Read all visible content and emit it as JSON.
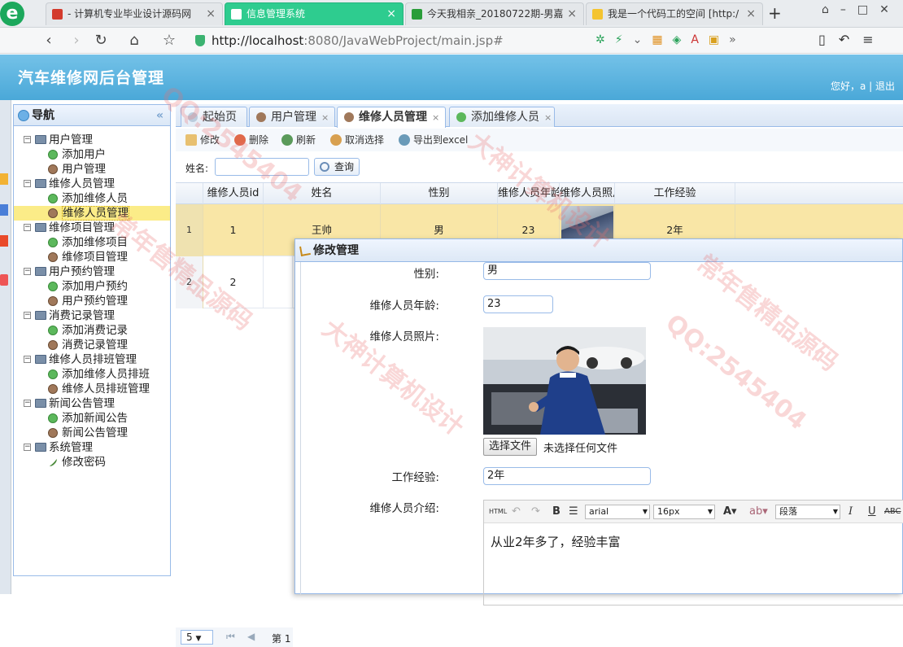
{
  "browser": {
    "tabs": [
      {
        "title": "- 计算机专业毕业设计源码网",
        "active": false,
        "color": "#d33a2c"
      },
      {
        "title": "信息管理系统",
        "active": true,
        "color": "#ffffff"
      },
      {
        "title": "今天我相亲_20180722期-男嘉",
        "active": false,
        "color": "#2a9d3a"
      },
      {
        "title": "我是一个代码工的空间 [http:/",
        "active": false,
        "color": "#f4c430"
      }
    ],
    "new_tab": "+",
    "url_host": "http://localhost",
    "url_rest": ":8080/JavaWebProject/main.jsp#"
  },
  "app": {
    "title": "汽车维修网后台管理",
    "greeting": "您好，a",
    "logout": "退出"
  },
  "nav": {
    "title": "导航",
    "groups": [
      {
        "label": "用户管理",
        "items": [
          {
            "label": "添加用户",
            "icon": "add"
          },
          {
            "label": "用户管理",
            "icon": "user"
          }
        ]
      },
      {
        "label": "维修人员管理",
        "items": [
          {
            "label": "添加维修人员",
            "icon": "add"
          },
          {
            "label": "维修人员管理",
            "icon": "user",
            "selected": true
          }
        ]
      },
      {
        "label": "维修项目管理",
        "items": [
          {
            "label": "添加维修项目",
            "icon": "add"
          },
          {
            "label": "维修项目管理",
            "icon": "user"
          }
        ]
      },
      {
        "label": "用户预约管理",
        "items": [
          {
            "label": "添加用户预约",
            "icon": "add"
          },
          {
            "label": "用户预约管理",
            "icon": "user"
          }
        ]
      },
      {
        "label": "消费记录管理",
        "items": [
          {
            "label": "添加消费记录",
            "icon": "add"
          },
          {
            "label": "消费记录管理",
            "icon": "user"
          }
        ]
      },
      {
        "label": "维修人员排班管理",
        "items": [
          {
            "label": "添加维修人员排班",
            "icon": "add"
          },
          {
            "label": "维修人员排班管理",
            "icon": "user"
          }
        ]
      },
      {
        "label": "新闻公告管理",
        "items": [
          {
            "label": "添加新闻公告",
            "icon": "add"
          },
          {
            "label": "新闻公告管理",
            "icon": "user"
          }
        ]
      },
      {
        "label": "系统管理",
        "items": [
          {
            "label": "修改密码",
            "icon": "pen"
          }
        ]
      }
    ]
  },
  "main": {
    "tabs": [
      {
        "label": "起始页",
        "closable": false
      },
      {
        "label": "用户管理",
        "closable": true
      },
      {
        "label": "维修人员管理",
        "closable": true,
        "active": true
      },
      {
        "label": "添加维修人员",
        "closable": true
      }
    ],
    "toolbar": {
      "edit": "修改",
      "delete": "删除",
      "refresh": "刷新",
      "cancel": "取消选择",
      "export": "导出到excel"
    },
    "search": {
      "name_label": "姓名:",
      "name_value": "",
      "query": "查询"
    },
    "grid": {
      "columns": [
        "维修人员id",
        "姓名",
        "性别",
        "维修人员年龄",
        "维修人员照片",
        "工作经验"
      ],
      "rows": [
        {
          "rownum": "1",
          "id": "1",
          "name": "王帅",
          "sex": "男",
          "age": "23",
          "exp": "2年",
          "selected": true
        },
        {
          "rownum": "2",
          "id": "2",
          "name": "",
          "sex": "",
          "age": "",
          "exp": "",
          "selected": false
        }
      ]
    },
    "pager": {
      "page_size": "5",
      "page_label": "第 1"
    }
  },
  "modal": {
    "title": "修改管理",
    "fields": {
      "sex_label": "性别:",
      "sex_value": "男",
      "age_label": "维修人员年龄:",
      "age_value": "23",
      "photo_label": "维修人员照片:",
      "file_button": "选择文件",
      "file_status": "未选择任何文件",
      "exp_label": "工作经验:",
      "exp_value": "2年",
      "intro_label": "维修人员介绍:"
    },
    "editor": {
      "font": "arial",
      "size": "16px",
      "paragraph": "段落",
      "content": "从业2年多了，经验丰富"
    }
  },
  "watermark": {
    "text1": "QQ:2545404",
    "text2": "大神计算机设计",
    "text3": "常年售精品源码"
  }
}
